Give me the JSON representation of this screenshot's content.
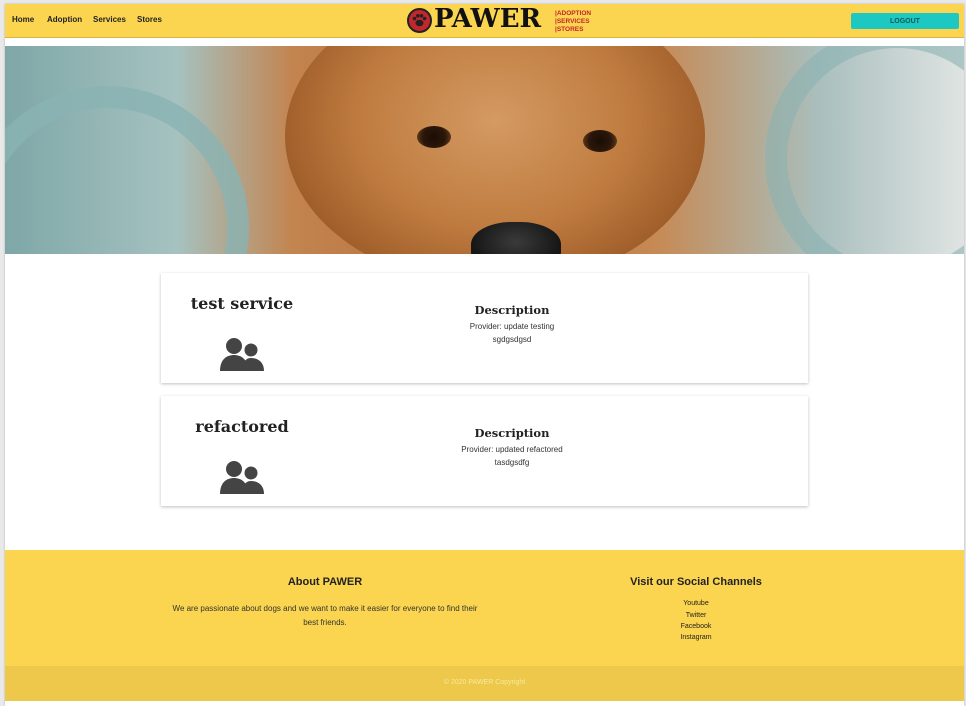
{
  "nav": {
    "links": [
      "Home",
      "Adoption",
      "Services",
      "Stores"
    ],
    "logo_word": "PAWER",
    "logo_tags": [
      "|ADOPTION",
      "|SERVICES",
      "|STORES"
    ],
    "logout_label": "LOGOUT"
  },
  "services": [
    {
      "title": "test service",
      "description_heading": "Description",
      "description_line1": "Provider: update testing",
      "description_line2": "sgdgsdgsd"
    },
    {
      "title": "refactored",
      "description_heading": "Description",
      "description_line1": "Provider: updated refactored",
      "description_line2": "tasdgsdfg"
    }
  ],
  "footer": {
    "about_title": "About PAWER",
    "about_text": "We are passionate about dogs and we want to make it easier for everyone to find their best friends.",
    "social_title": "Visit our Social Channels",
    "social_links": [
      "Youtube",
      "Twitter",
      "Facebook",
      "Instagram"
    ],
    "copyright": "© 2020 PAWER Copyright"
  },
  "colors": {
    "nav_bg": "#fbd54f",
    "logout_bg": "#1ec8c2",
    "footer_bg": "#fbd54f",
    "copyright_bg": "#edc84a"
  },
  "icons": {
    "card_icon": "people-group-icon",
    "logo_icon": "paw-icon"
  }
}
